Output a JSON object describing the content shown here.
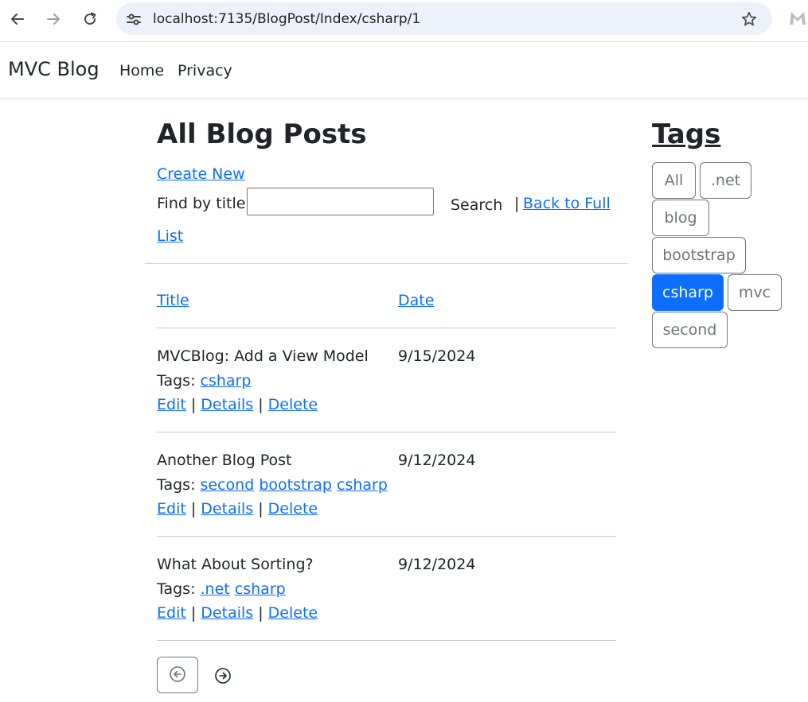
{
  "browser": {
    "url": "localhost:7135/BlogPost/Index/csharp/1"
  },
  "navbar": {
    "brand": "MVC Blog",
    "links": [
      "Home",
      "Privacy"
    ]
  },
  "main": {
    "title": "All Blog Posts",
    "create_new": "Create New",
    "find_label": "Find by title:",
    "search_value": "",
    "search_button": "Search",
    "separator": "|",
    "back_line1": "Back to Full",
    "back_line2": "List",
    "columns": [
      "Title",
      "Date"
    ],
    "tags_prefix": "Tags:",
    "actions": {
      "edit": "Edit",
      "details": "Details",
      "delete": "Delete",
      "sep": "|"
    },
    "posts": [
      {
        "title": "MVCBlog: Add a View Model",
        "date": "9/15/2024",
        "tags": [
          "csharp"
        ]
      },
      {
        "title": "Another Blog Post",
        "date": "9/12/2024",
        "tags": [
          "second",
          "bootstrap",
          "csharp"
        ]
      },
      {
        "title": "What About Sorting?",
        "date": "9/12/2024",
        "tags": [
          ".net",
          "csharp"
        ]
      }
    ]
  },
  "pager": {
    "prev_icon": "arrow-left-circle-icon",
    "next_icon": "arrow-right-circle-icon"
  },
  "sidebar": {
    "title": "Tags",
    "tags": [
      "All",
      ".net",
      "blog",
      "bootstrap",
      "csharp",
      "mvc",
      "second"
    ],
    "active_tag": "csharp"
  },
  "colors": {
    "link": "#0d6efd",
    "active_tag_bg": "#0d6efd",
    "tag_border": "#6c757d",
    "omnibox_bg": "#edf2fa"
  }
}
